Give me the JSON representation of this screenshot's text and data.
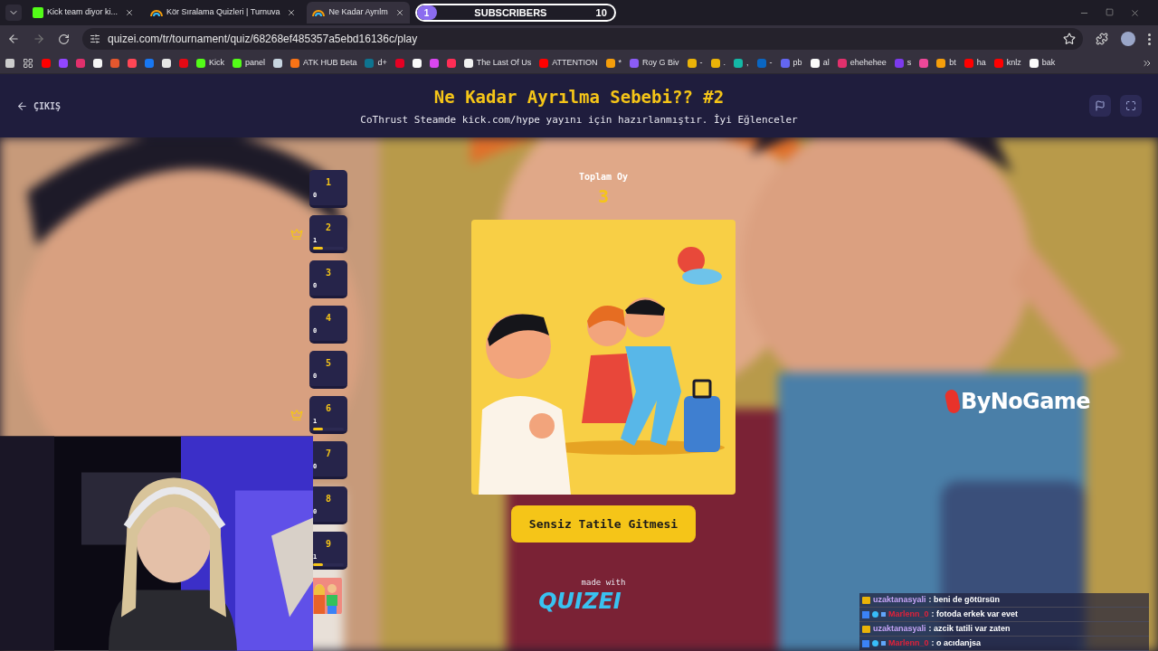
{
  "browser": {
    "tabs": [
      {
        "title": "Kick team diyor ki...",
        "selected": false,
        "kind": "kick"
      },
      {
        "title": "Kör Sıralama Quizleri | Turnuva",
        "selected": false,
        "kind": "quiz"
      },
      {
        "title": "Ne Kadar Ayrılm",
        "selected": true,
        "kind": "quiz"
      }
    ],
    "address": "quizei.com/tr/tournament/quiz/68268ef485357a5ebd16136c/play",
    "bookmarks": [
      {
        "color": "#ff0000"
      },
      {
        "color": "#9146ff"
      },
      {
        "color": "#e1306c"
      },
      {
        "color": "#f5f5f5"
      },
      {
        "color": "#e4572e"
      },
      {
        "color": "#ff4655"
      },
      {
        "color": "#1877f2"
      },
      {
        "color": "#e5e5e5"
      },
      {
        "color": "#e50914"
      },
      {
        "label": "Kick",
        "color": "#53fc18"
      },
      {
        "label": "panel",
        "color": "#53fc18"
      },
      {
        "color": "#c7d5e0"
      },
      {
        "label": "ATK HUB Beta",
        "color": "#f97316"
      },
      {
        "label": "d+",
        "color": "#0e7490"
      },
      {
        "color": "#e60023"
      },
      {
        "color": "#fafafa"
      },
      {
        "color": "#d946ef"
      },
      {
        "color": "#ff2d55"
      },
      {
        "label": "The Last Of Us",
        "color": "#f1f1f1"
      },
      {
        "label": "ATTENTION",
        "color": "#ff0000"
      },
      {
        "label": "*",
        "color": "#f59e0b"
      },
      {
        "label": "Roy G Biv",
        "color": "#8b5cf6"
      },
      {
        "label": "-",
        "color": "#eab308"
      },
      {
        "label": ".",
        "color": "#eab308"
      },
      {
        "label": ",",
        "color": "#14b8a6"
      },
      {
        "label": "-",
        "color": "#0a66c2"
      },
      {
        "label": "pb",
        "color": "#6366f1"
      },
      {
        "label": "al",
        "color": "#fafafa"
      },
      {
        "label": "ehehehee",
        "color": "#e1306c"
      },
      {
        "label": "s",
        "color": "#7c3aed"
      },
      {
        "color": "#ec4899"
      },
      {
        "label": "bt",
        "color": "#f59e0b"
      },
      {
        "label": "ha",
        "color": "#ff0000"
      },
      {
        "label": "knlz",
        "color": "#ff0000"
      },
      {
        "label": "bak",
        "color": "#fafafa"
      }
    ]
  },
  "header": {
    "back": "ÇIKIŞ",
    "title": "Ne Kadar Ayrılma Sebebi?? #2",
    "subtitle": "CoThrust Steamde kick.com/hype yayını için hazırlanmıştır. İyi Eğlenceler"
  },
  "rounds": [
    {
      "kind": "number",
      "label": "1",
      "votes": "0",
      "crown": false
    },
    {
      "kind": "number",
      "label": "2",
      "votes": "1",
      "crown": true,
      "level": 0.33
    },
    {
      "kind": "number",
      "label": "3",
      "votes": "0",
      "crown": false
    },
    {
      "kind": "number",
      "label": "4",
      "votes": "0",
      "crown": false
    },
    {
      "kind": "number",
      "label": "5",
      "votes": "0",
      "crown": false
    },
    {
      "kind": "number",
      "label": "6",
      "votes": "1",
      "crown": true,
      "level": 0.33
    },
    {
      "kind": "number",
      "label": "7",
      "votes": "0",
      "crown": false
    },
    {
      "kind": "number",
      "label": "8",
      "votes": "0",
      "crown": false
    },
    {
      "kind": "number",
      "label": "9",
      "votes": "1",
      "crown": false,
      "level": 0.33
    },
    {
      "kind": "picture"
    }
  ],
  "total": {
    "label": "Toplam Oy",
    "value": "3"
  },
  "choice": "Sensiz Tatile Gitmesi",
  "footer": {
    "made_with": "made with",
    "logo": "QUIZEI"
  },
  "overlay": {
    "goal": {
      "current": "1",
      "label": "SUBSCRIBERS",
      "target": "10",
      "level": 0.1
    },
    "brand": "ByNoGame",
    "chat": [
      {
        "user": "uzaktanasyali",
        "color": "#c4a3f5",
        "kind": "crown",
        "text": ": beni de götürsün"
      },
      {
        "user": "Marlenn_0",
        "color": "#e0213a",
        "kind": "multi",
        "text": ": fotoda erkek var evet"
      },
      {
        "user": "uzaktanasyali",
        "color": "#c4a3f5",
        "kind": "crown",
        "text": ": azcik tatili var zaten"
      },
      {
        "user": "Marlenn_0",
        "color": "#e0213a",
        "kind": "multi",
        "text": ": o acıdanjsa"
      }
    ]
  }
}
